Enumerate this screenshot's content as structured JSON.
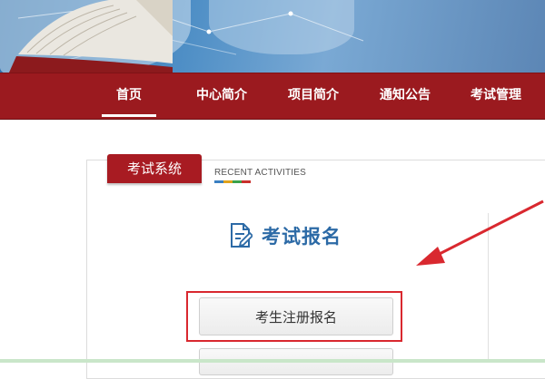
{
  "nav": {
    "items": [
      {
        "label": "首页",
        "active": true
      },
      {
        "label": "中心简介",
        "active": false
      },
      {
        "label": "项目简介",
        "active": false
      },
      {
        "label": "通知公告",
        "active": false
      },
      {
        "label": "考试管理",
        "active": false
      }
    ]
  },
  "panel": {
    "tab_label": "考试系统",
    "recent_activities": "RECENT ACTIVITIES",
    "recent_bar_colors": [
      "#3a7fc1",
      "#e0a21b",
      "#3aa24b",
      "#c9302c"
    ],
    "section_title": "考试报名",
    "section_icon": "edit-document-icon",
    "register_button": "考生注册报名"
  },
  "colors": {
    "nav_bg": "#9b1a1f",
    "tab_bg": "#a81b22",
    "title_blue": "#2c6aa6",
    "highlight_red": "#d9282f"
  }
}
